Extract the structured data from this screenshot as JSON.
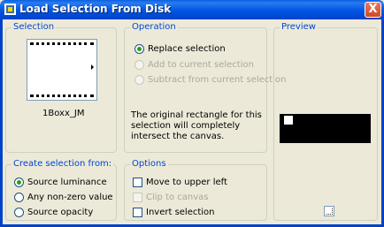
{
  "window": {
    "title": "Load Selection From Disk",
    "close_glyph": "X"
  },
  "selection": {
    "group_title": "Selection",
    "file_name": "1Boxx_JM"
  },
  "operation": {
    "group_title": "Operation",
    "options": [
      {
        "label": "Replace selection",
        "checked": true,
        "enabled": true
      },
      {
        "label": "Add to current selection",
        "checked": false,
        "enabled": false
      },
      {
        "label": "Subtract from current selection",
        "checked": false,
        "enabled": false
      }
    ],
    "description": "The original rectangle for this selection will completely intersect the canvas."
  },
  "preview": {
    "group_title": "Preview"
  },
  "create_from": {
    "group_title": "Create selection from:",
    "options": [
      {
        "label": "Source luminance",
        "checked": true
      },
      {
        "label": "Any non-zero value",
        "checked": false
      },
      {
        "label": "Source opacity",
        "checked": false
      }
    ]
  },
  "options": {
    "group_title": "Options",
    "items": [
      {
        "label": "Move to upper left",
        "checked": false,
        "enabled": true
      },
      {
        "label": "Clip to canvas",
        "checked": false,
        "enabled": false
      },
      {
        "label": "Invert selection",
        "checked": false,
        "enabled": true
      }
    ]
  },
  "icons": {
    "title_icon": "app-icon",
    "close": "close-icon",
    "resize": "resize-grip-icon"
  },
  "colors": {
    "title_bar": "#0054e3",
    "group_title": "#0046d5",
    "dialog_bg": "#ece9d8",
    "radio_dot": "#21a121"
  }
}
